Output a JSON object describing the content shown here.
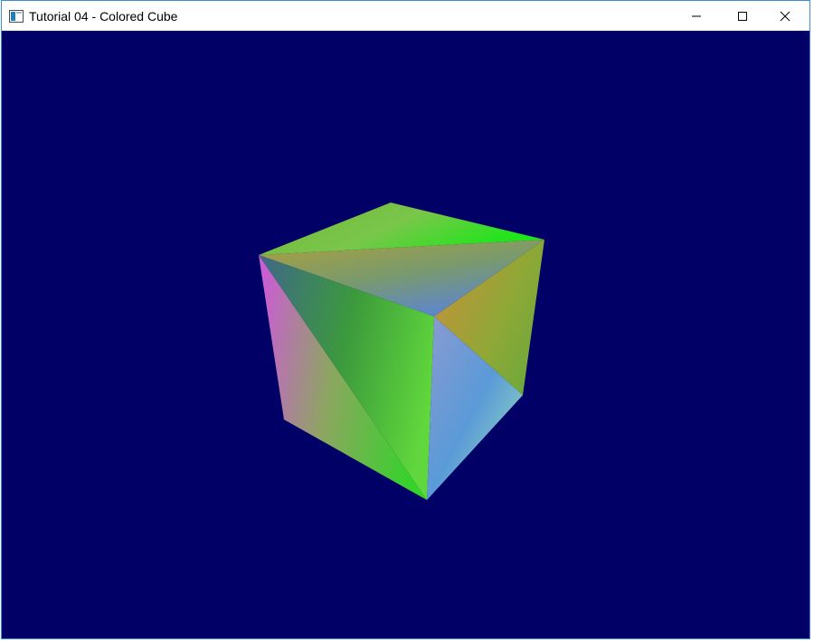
{
  "window": {
    "title": "Tutorial 04 - Colored Cube",
    "icons": {
      "app": "window-app-icon",
      "minimize": "minimize-icon",
      "maximize": "maximize-icon",
      "close": "close-icon"
    }
  },
  "scene": {
    "clear_color": "#000066",
    "object": "colored-cube"
  }
}
